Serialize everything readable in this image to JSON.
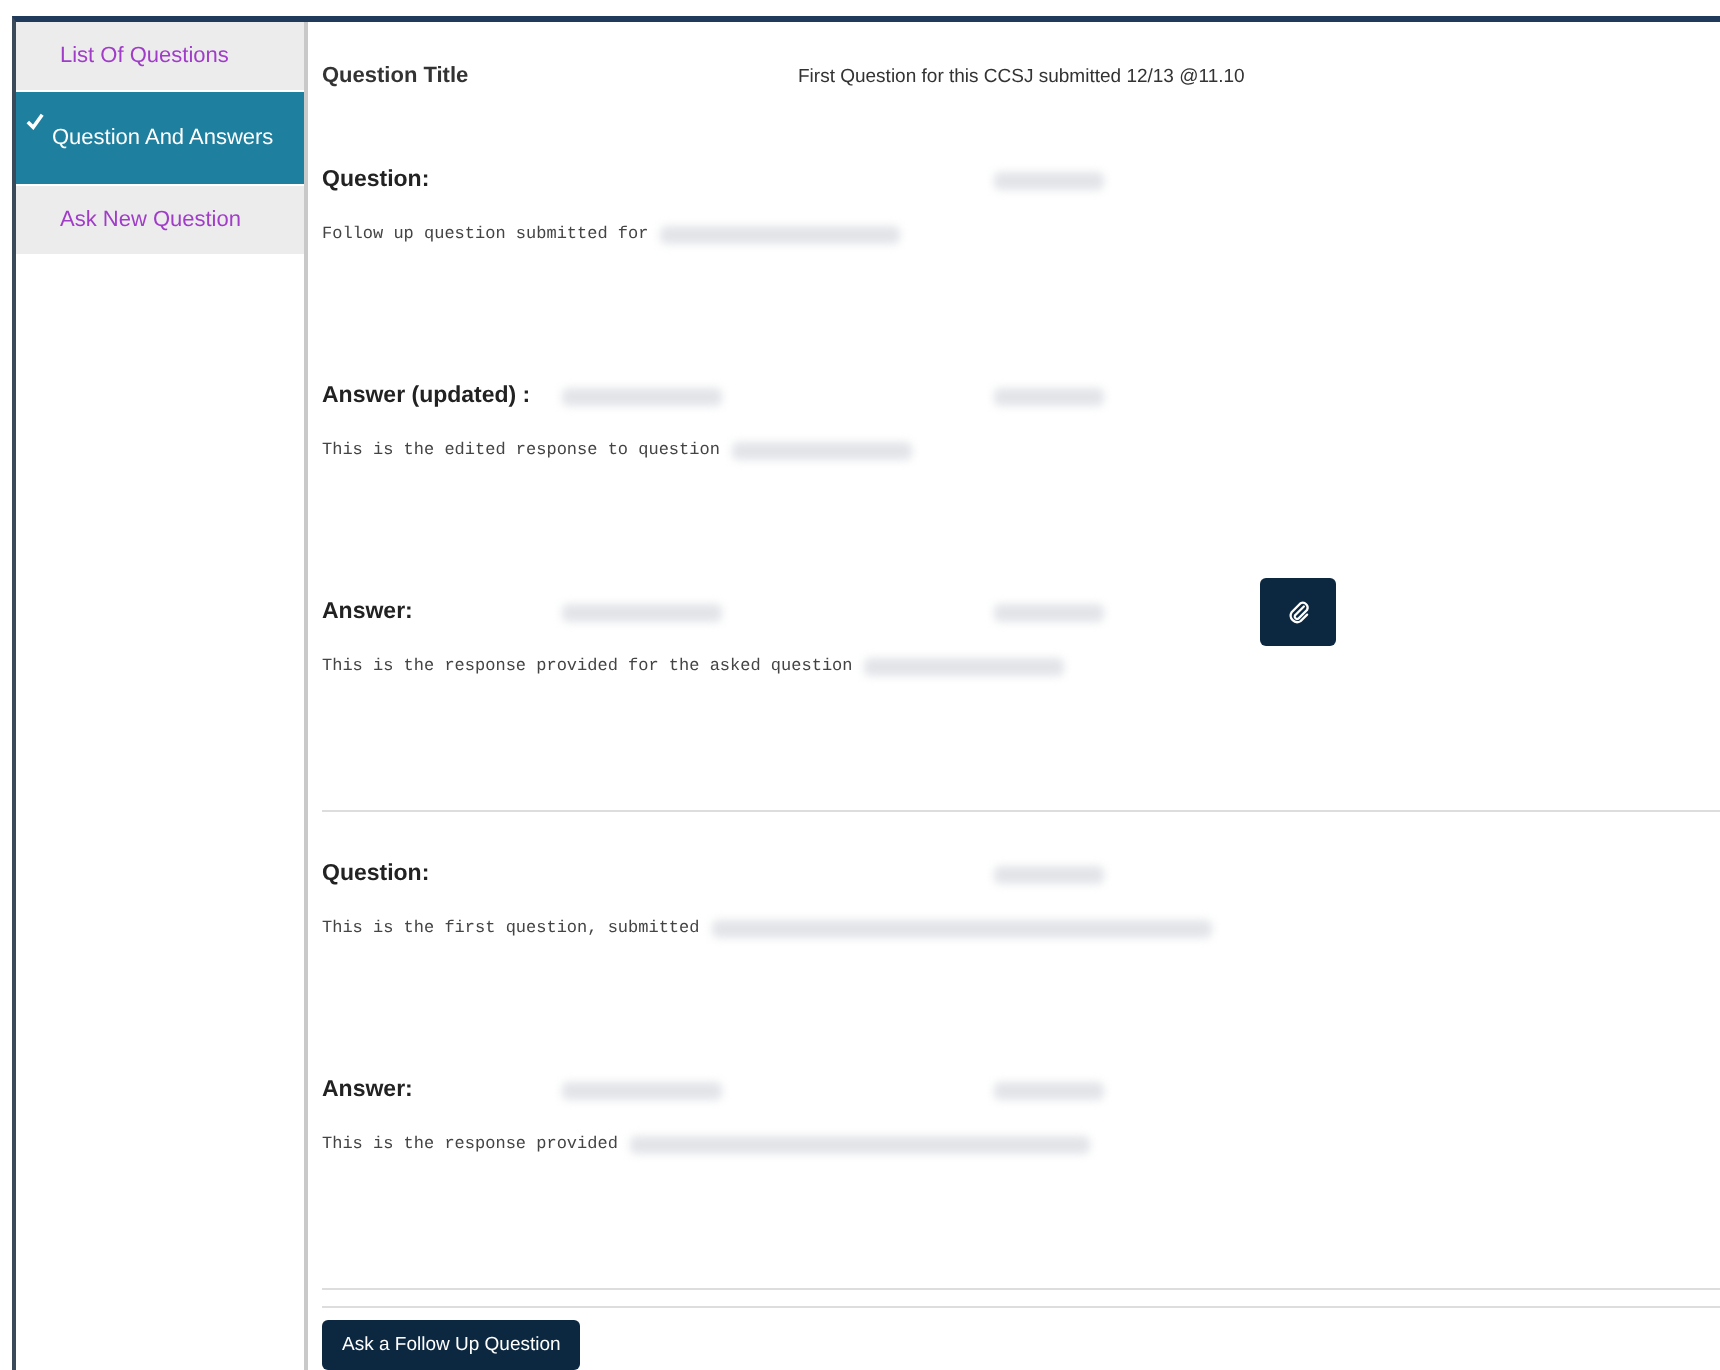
{
  "sidebar": {
    "items": [
      {
        "label": "List Of Questions",
        "selected": false
      },
      {
        "label": "Question And Answers",
        "selected": true
      },
      {
        "label": "Ask New Question",
        "selected": false
      }
    ]
  },
  "header": {
    "label": "Question Title",
    "value": "First Question for this CCSJ submitted 12/13 @11.10"
  },
  "threads": [
    {
      "entries": [
        {
          "kind": "question",
          "label": "Question:",
          "body": "Follow up question submitted for",
          "attachment": false
        },
        {
          "kind": "answer",
          "label": "Answer (updated) :",
          "body": "This is the edited response to question",
          "attachment": false
        },
        {
          "kind": "answer",
          "label": "Answer:",
          "body": "This is the response provided for the asked question",
          "attachment": true
        }
      ]
    },
    {
      "entries": [
        {
          "kind": "question",
          "label": "Question:",
          "body": "This is the first question, submitted",
          "attachment": false
        },
        {
          "kind": "answer",
          "label": "Answer:",
          "body": "This is the response provided",
          "attachment": false
        }
      ]
    }
  ],
  "follow_up_button": "Ask a Follow Up Question"
}
